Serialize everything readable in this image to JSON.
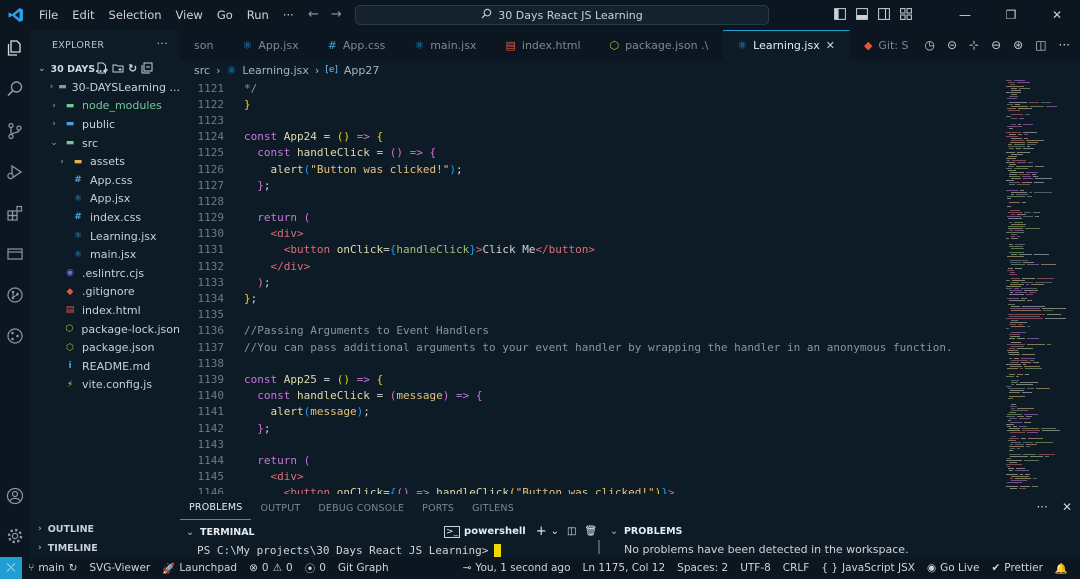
{
  "titlebar": {
    "menu": [
      "File",
      "Edit",
      "Selection",
      "View",
      "Go",
      "Run",
      "···"
    ],
    "search_text": "30 Days React JS Learning"
  },
  "sidebar": {
    "header": "EXPLORER",
    "project": "30 DAYS...",
    "tree": [
      {
        "name": "30-DAYSLearning ...",
        "indent": 1,
        "chevron": "›",
        "icon": "folder",
        "color": "#c9d1d9"
      },
      {
        "name": "node_modules",
        "indent": 1,
        "chevron": "›",
        "icon": "folder-green",
        "color": "#73c991"
      },
      {
        "name": "public",
        "indent": 1,
        "chevron": "›",
        "icon": "folder-blue",
        "color": "#c9d1d9"
      },
      {
        "name": "src",
        "indent": 1,
        "chevron": "⌄",
        "icon": "folder-src",
        "color": "#c9d1d9"
      },
      {
        "name": "assets",
        "indent": 2,
        "chevron": "›",
        "icon": "folder-yellow",
        "color": "#c9d1d9"
      },
      {
        "name": "App.css",
        "indent": 2,
        "chevron": "",
        "icon": "css",
        "color": "#c9d1d9"
      },
      {
        "name": "App.jsx",
        "indent": 2,
        "chevron": "",
        "icon": "react",
        "color": "#c9d1d9"
      },
      {
        "name": "index.css",
        "indent": 2,
        "chevron": "",
        "icon": "css",
        "color": "#c9d1d9"
      },
      {
        "name": "Learning.jsx",
        "indent": 2,
        "chevron": "",
        "icon": "react",
        "color": "#c9d1d9"
      },
      {
        "name": "main.jsx",
        "indent": 2,
        "chevron": "",
        "icon": "react",
        "color": "#c9d1d9"
      },
      {
        "name": ".eslintrc.cjs",
        "indent": 1,
        "chevron": "",
        "icon": "eslint",
        "color": "#c9d1d9"
      },
      {
        "name": ".gitignore",
        "indent": 1,
        "chevron": "",
        "icon": "git",
        "color": "#c9d1d9"
      },
      {
        "name": "index.html",
        "indent": 1,
        "chevron": "",
        "icon": "html",
        "color": "#c9d1d9"
      },
      {
        "name": "package-lock.json",
        "indent": 1,
        "chevron": "",
        "icon": "node",
        "color": "#c9d1d9"
      },
      {
        "name": "package.json",
        "indent": 1,
        "chevron": "",
        "icon": "node",
        "color": "#c9d1d9"
      },
      {
        "name": "README.md",
        "indent": 1,
        "chevron": "",
        "icon": "info",
        "color": "#c9d1d9"
      },
      {
        "name": "vite.config.js",
        "indent": 1,
        "chevron": "",
        "icon": "vite",
        "color": "#c9d1d9"
      }
    ],
    "outline": "OUTLINE",
    "timeline": "TIMELINE"
  },
  "tabs": [
    {
      "label": "son",
      "icon": "none",
      "active": false
    },
    {
      "label": "App.jsx",
      "icon": "react",
      "active": false
    },
    {
      "label": "App.css",
      "icon": "css",
      "active": false
    },
    {
      "label": "main.jsx",
      "icon": "react",
      "active": false
    },
    {
      "label": "index.html",
      "icon": "html",
      "active": false
    },
    {
      "label": "package.json .\\",
      "icon": "node",
      "active": false
    },
    {
      "label": "Learning.jsx",
      "icon": "react",
      "active": true
    },
    {
      "label": "Git: S",
      "icon": "git",
      "active": false
    }
  ],
  "breadcrumb": {
    "folder": "src",
    "file": "Learning.jsx",
    "symbol": "App27"
  },
  "editor": {
    "lines": [
      {
        "n": "1121",
        "html": "<span class=\"cm\">*/</span>"
      },
      {
        "n": "1122",
        "html": "<span class=\"br\">}</span>"
      },
      {
        "n": "1123",
        "html": ""
      },
      {
        "n": "1124",
        "html": "<span class=\"kw\">const</span> <span class=\"fn\">App24</span> = <span class=\"br\">()</span> <span class=\"kw\">=&gt;</span> <span class=\"br\">{</span>"
      },
      {
        "n": "1125",
        "html": "  <span class=\"kw\">const</span> <span class=\"fn\">handleClick</span> = <span class=\"brp\">()</span> <span class=\"kw\">=&gt;</span> <span class=\"brp\">{</span>"
      },
      {
        "n": "1126",
        "html": "    <span class=\"fn\">alert</span><span class=\"brb\">(</span><span class=\"str\">\"Button was clicked!\"</span><span class=\"brb\">)</span>;"
      },
      {
        "n": "1127",
        "html": "  <span class=\"brp\">}</span>;"
      },
      {
        "n": "1128",
        "html": ""
      },
      {
        "n": "1129",
        "html": "  <span class=\"kw\">return</span> <span class=\"brp\">(</span>"
      },
      {
        "n": "1130",
        "html": "    <span class=\"tag\">&lt;div&gt;</span>"
      },
      {
        "n": "1131",
        "html": "      <span class=\"tag\">&lt;button</span> <span class=\"fn\">onClick</span>=<span class=\"brb\">{</span><span class=\"attr\">handleClick</span><span class=\"brb\">}</span><span class=\"tag\">&gt;</span>Click Me<span class=\"tag\">&lt;/button&gt;</span>"
      },
      {
        "n": "1132",
        "html": "    <span class=\"tag\">&lt;/div&gt;</span>"
      },
      {
        "n": "1133",
        "html": "  <span class=\"brp\">)</span>;"
      },
      {
        "n": "1134",
        "html": "<span class=\"br\">}</span>;"
      },
      {
        "n": "1135",
        "html": ""
      },
      {
        "n": "1136",
        "html": "<span class=\"cm\">//Passing Arguments to Event Handlers</span>"
      },
      {
        "n": "1137",
        "html": "<span class=\"cm\">//You can pass additional arguments to your event handler by wrapping the handler in an anonymous function.</span>"
      },
      {
        "n": "1138",
        "html": ""
      },
      {
        "n": "1139",
        "html": "<span class=\"kw\">const</span> <span class=\"fn\">App25</span> = <span class=\"br\">()</span> <span class=\"kw\">=&gt;</span> <span class=\"br\">{</span>"
      },
      {
        "n": "1140",
        "html": "  <span class=\"kw\">const</span> <span class=\"fn\">handleClick</span> = <span class=\"brp\">(</span><span class=\"pm\">message</span><span class=\"brp\">)</span> <span class=\"kw\">=&gt;</span> <span class=\"brp\">{</span>"
      },
      {
        "n": "1141",
        "html": "    <span class=\"fn\">alert</span><span class=\"brb\">(</span><span class=\"var\">message</span><span class=\"brb\">)</span>;"
      },
      {
        "n": "1142",
        "html": "  <span class=\"brp\">}</span>;"
      },
      {
        "n": "1143",
        "html": ""
      },
      {
        "n": "1144",
        "html": "  <span class=\"kw\">return</span> <span class=\"brp\">(</span>"
      },
      {
        "n": "1145",
        "html": "    <span class=\"tag\">&lt;div&gt;</span>"
      },
      {
        "n": "1146",
        "html": "      <span class=\"tag\">&lt;button</span> <span class=\"fn\">onClick</span>=<span class=\"brb\">{</span><span class=\"brp\">()</span> <span class=\"kw\">=&gt;</span> <span class=\"fn\">handleClick</span><span class=\"br\">(</span><span class=\"str\">\"Button was clicked!\"</span><span class=\"br\">)</span><span class=\"brb\">}</span><span class=\"tag\">&gt;</span>"
      }
    ]
  },
  "panel": {
    "tabs": [
      "PROBLEMS",
      "OUTPUT",
      "DEBUG CONSOLE",
      "PORTS",
      "GITLENS"
    ],
    "terminal_title": "TERMINAL",
    "shell": "powershell",
    "problems_title": "PROBLEMS",
    "prompt": "PS C:\\My projects\\30 Days React JS Learning>",
    "problems_message": "No problems have been detected in the workspace."
  },
  "status": {
    "branch": "main",
    "svg_viewer": "SVG-Viewer",
    "launchpad": "Launchpad",
    "errors": "0",
    "warnings": "0",
    "ports": "0",
    "git_graph": "Git Graph",
    "blame": "You, 1 second ago",
    "position": "Ln 1175, Col 12",
    "spaces": "Spaces: 2",
    "encoding": "UTF-8",
    "eol": "CRLF",
    "language": "JavaScript JSX",
    "go_live": "Go Live",
    "prettier": "Prettier"
  },
  "colors": {
    "accent": "#1f9fd4",
    "background": "#0d1b26",
    "chrome": "#0b1620"
  }
}
